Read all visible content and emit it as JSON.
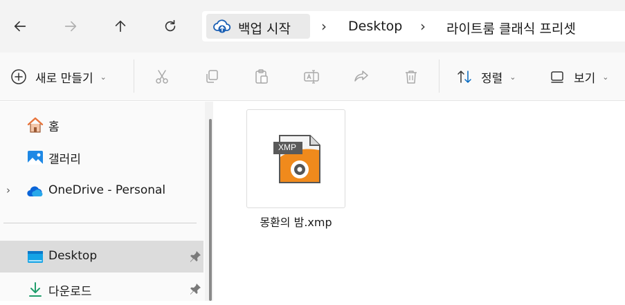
{
  "navigation": {
    "back_icon": "arrow-left-icon",
    "forward_icon": "arrow-right-icon",
    "up_icon": "arrow-up-icon",
    "refresh_icon": "refresh-icon"
  },
  "breadcrumb": {
    "items": [
      {
        "label": "백업 시작",
        "icon": "cloud-backup-icon"
      },
      {
        "label": "Desktop"
      },
      {
        "label": "라이트룸 클래식 프리셋"
      }
    ],
    "separator": "›"
  },
  "toolbar": {
    "new_label": "새로 만들기",
    "sort_label": "정렬",
    "view_label": "보기",
    "actions": [
      "cut-icon",
      "copy-icon",
      "paste-icon",
      "rename-icon",
      "share-icon",
      "delete-icon"
    ]
  },
  "sidebar": {
    "items": [
      {
        "label": "홈",
        "icon": "home-icon"
      },
      {
        "label": "갤러리",
        "icon": "gallery-icon"
      },
      {
        "label": "OneDrive - Personal",
        "icon": "onedrive-icon",
        "expandable": true
      },
      {
        "label": "Desktop",
        "icon": "desktop-folder-icon",
        "pinned": true,
        "selected": true
      },
      {
        "label": "다운로드",
        "icon": "download-icon",
        "pinned": true
      }
    ]
  },
  "files": [
    {
      "name": "몽환의 밤.xmp",
      "badge": "XMP",
      "icon": "xmp-file-icon"
    }
  ],
  "colors": {
    "accent": "#0067c0",
    "xmp_orange": "#f08a1c",
    "home_roof": "#e8743b"
  }
}
